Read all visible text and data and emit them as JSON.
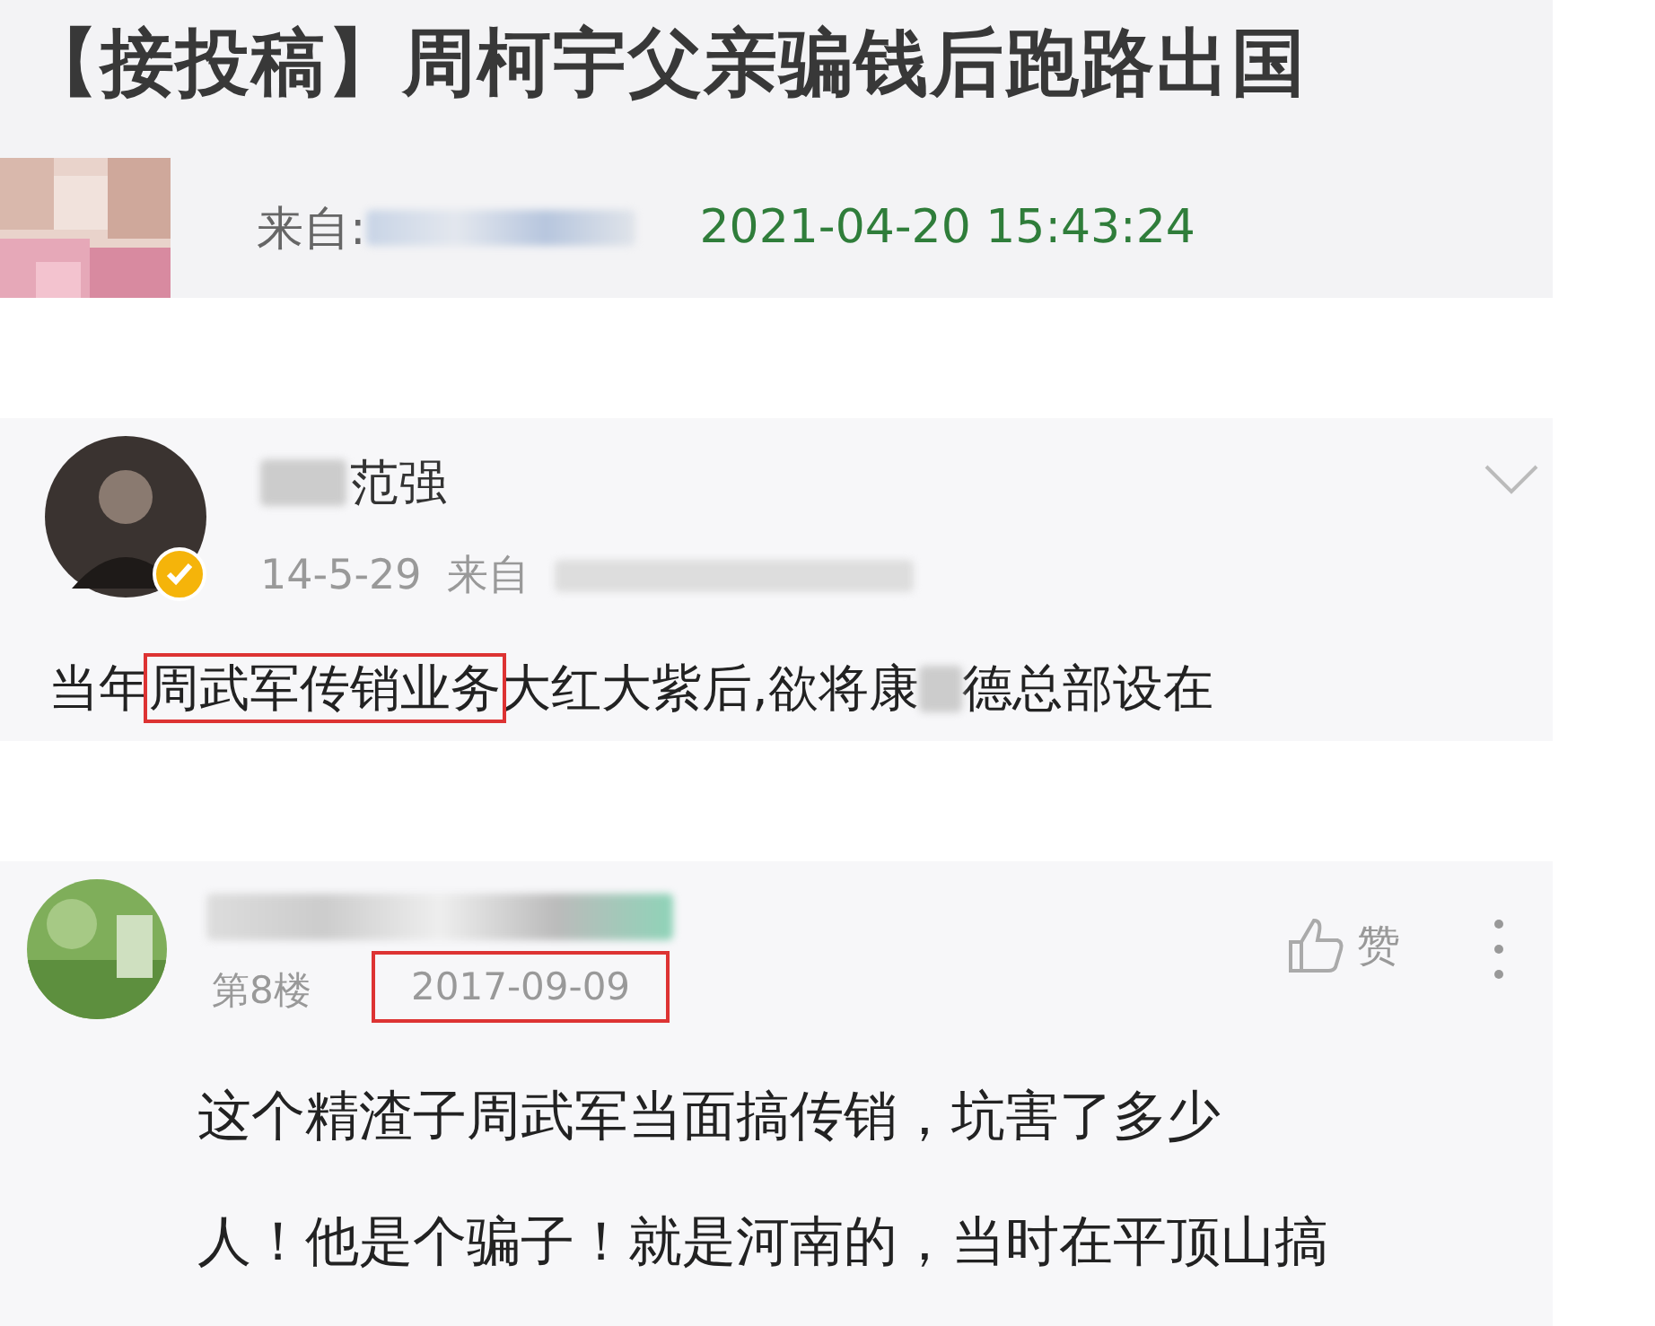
{
  "article_header": {
    "title": "【接投稿】周柯宇父亲骗钱后跑路出国",
    "source_label": "来自:",
    "date": "2021-04-20 15:43:24"
  },
  "post": {
    "name": "范强",
    "verified": true,
    "date": "14-5-29",
    "source_label": "来自",
    "body_parts": [
      {
        "text": "当年",
        "boxed": false
      },
      {
        "text": "周武军传销业务",
        "boxed": true
      },
      {
        "text": "大红大紫后,欲将康",
        "boxed": false
      }
    ],
    "body_rest": "德总部设在"
  },
  "comment": {
    "floor": "第8楼",
    "date": "2017-09-09",
    "date_boxed": true,
    "like_label": "赞",
    "lines": [
      "这个精渣子周武军当面搞传销，坑害了多少",
      "人！他是个骗子！就是河南的，当时在平顶山搞"
    ]
  }
}
